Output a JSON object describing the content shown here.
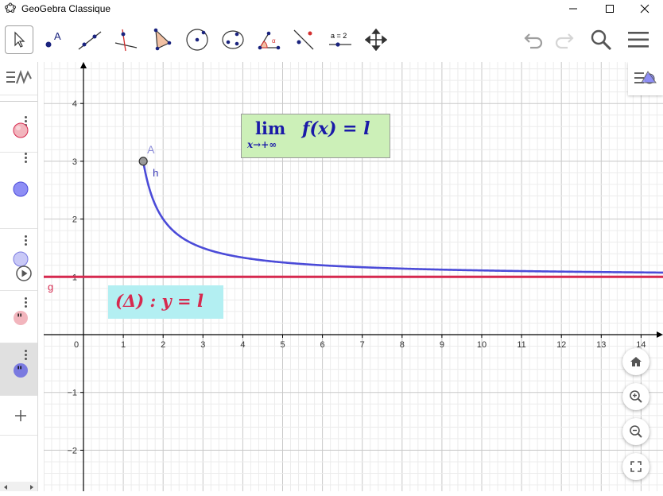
{
  "window": {
    "title": "GeoGebra Classique"
  },
  "toolbar": {
    "undo_label": "undo",
    "redo_label": "redo",
    "search_label": "search",
    "menu_label": "menu",
    "slider_tool_text": "a = 2"
  },
  "graph": {
    "x_ticks": [
      "0",
      "1",
      "2",
      "3",
      "4",
      "5",
      "6",
      "7",
      "8",
      "9",
      "10",
      "11",
      "12",
      "13",
      "14"
    ],
    "y_ticks_pos": [
      "4",
      "3",
      "2",
      "1"
    ],
    "y_ticks_neg": [
      "−1",
      "−2"
    ],
    "point_label": "A",
    "curve_label": "h",
    "line_label": "g",
    "limit_box": {
      "lim": "lim",
      "sub": "x→+∞",
      "expr": "f(x) = l"
    },
    "delta_box": {
      "text": "(Δ) : y = l"
    },
    "colors": {
      "curve": "#4b4bd8",
      "line": "#d6294f",
      "limit_bg": "#ccf0b8",
      "delta_bg": "#b3eff2",
      "axis": "#000000"
    }
  }
}
